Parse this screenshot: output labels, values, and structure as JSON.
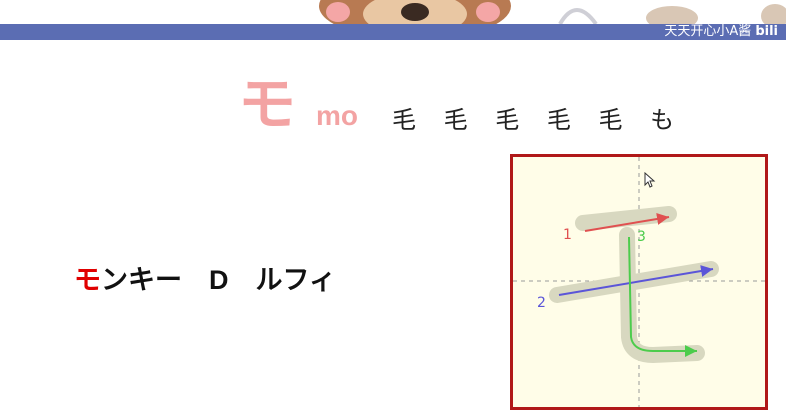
{
  "watermark": {
    "text": "天天开心小A酱",
    "logo": "bili"
  },
  "lesson": {
    "kana": "モ",
    "romaji": "mo",
    "stroke_sequence": "毛 毛 毛 毛 毛 も"
  },
  "example": {
    "highlight": "モ",
    "rest": "ンキー　D　ルフィ"
  },
  "stroke_board": {
    "labels": [
      "1",
      "2",
      "3"
    ],
    "colors": {
      "stroke1": "#e05050",
      "stroke2": "#5b55d8",
      "stroke3": "#4ccc4c",
      "border": "#b01818",
      "background": "#fffde8",
      "trace": "#d8d8c0"
    }
  },
  "colors": {
    "topbar": "#5b6db3",
    "title": "#f3a3a3",
    "highlight": "#e00000"
  }
}
